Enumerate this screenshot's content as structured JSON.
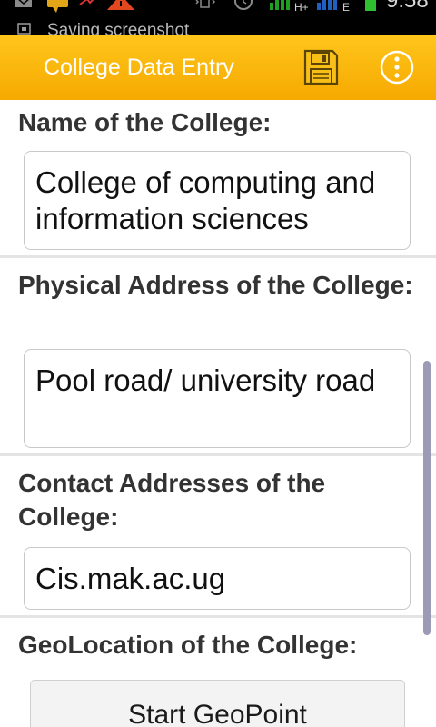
{
  "status_bar": {
    "notification_text": "Saving screenshot",
    "time": "9:58",
    "network_labels": [
      "H+",
      "E"
    ],
    "icons": [
      "email-icon",
      "chat-icon",
      "missed-call-icon",
      "warning-icon",
      "vibrate-icon",
      "alarm-icon",
      "signal-icon",
      "battery-icon",
      "screenshot-icon"
    ]
  },
  "app_bar": {
    "title": "College Data Entry",
    "save_icon": "floppy-disk-icon",
    "overflow_icon": "more-vertical-icon",
    "color": "#f8b200"
  },
  "form": {
    "name_label": "Name of the College:",
    "name_value": "College of computing and information sciences",
    "address_label": "Physical Address of the College:",
    "address_value": "Pool road/ university road",
    "contact_label": "Contact Addresses of the College:",
    "contact_value": "Cis.mak.ac.ug",
    "geo_label": "GeoLocation of the College:",
    "geo_button": "Start GeoPoint"
  },
  "colors": {
    "accent": "#f8b200",
    "label": "#333333",
    "scrollbar": "#9b9bb8"
  }
}
